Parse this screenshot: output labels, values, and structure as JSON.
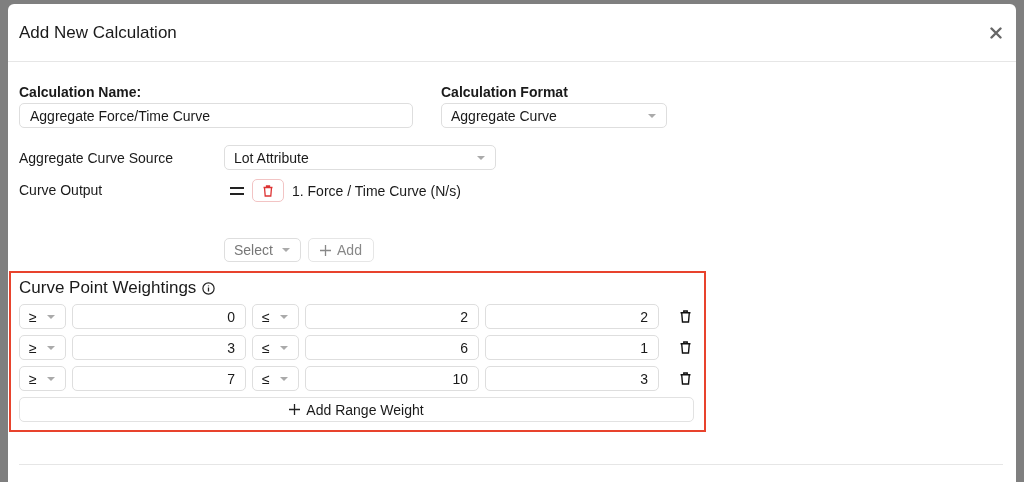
{
  "dialog": {
    "title": "Add New Calculation"
  },
  "name_field": {
    "label": "Calculation Name:",
    "value": "Aggregate Force/Time Curve"
  },
  "format_field": {
    "label": "Calculation Format",
    "value": "Aggregate Curve"
  },
  "source_field": {
    "label": "Aggregate Curve Source",
    "value": "Lot Attribute"
  },
  "curve_output": {
    "label": "Curve Output",
    "items": [
      "1. Force / Time Curve (N/s)"
    ],
    "select_placeholder": "Select",
    "add_label": "Add"
  },
  "weightings": {
    "title": "Curve Point Weightings",
    "rows": [
      {
        "op_low": "≥",
        "low": "0",
        "op_high": "≤",
        "high": "2",
        "weight": "2"
      },
      {
        "op_low": "≥",
        "low": "3",
        "op_high": "≤",
        "high": "6",
        "weight": "1"
      },
      {
        "op_low": "≥",
        "low": "7",
        "op_high": "≤",
        "high": "10",
        "weight": "3"
      }
    ],
    "add_label": "Add Range Weight"
  }
}
